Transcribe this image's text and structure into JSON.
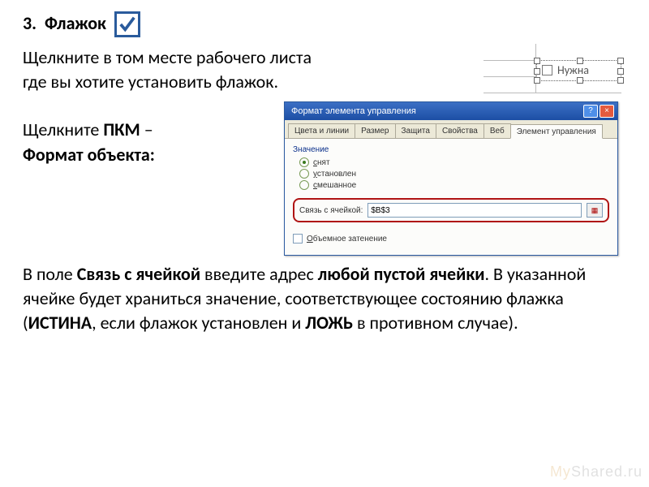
{
  "heading": {
    "number": "3.",
    "title": "Флажок"
  },
  "para1_line1": "Щелкните в том месте рабочего листа",
  "para1_line2": "где вы хотите установить флажок.",
  "rmb_instruction": {
    "prefix": "Щелкните ",
    "pkm": "ПКМ",
    "dash": " – ",
    "rest": "Формат объекта:"
  },
  "sample_checkbox_label": "Нужна",
  "dialog": {
    "title": "Формат элемента управления",
    "tabs": [
      "Цвета и линии",
      "Размер",
      "Защита",
      "Свойства",
      "Веб",
      "Элемент управления"
    ],
    "active_tab_index": 5,
    "group_label": "Значение",
    "radios": [
      {
        "label_u": "с",
        "label_rest": "нят",
        "selected": true
      },
      {
        "label_u": "у",
        "label_rest": "становлен",
        "selected": false
      },
      {
        "label_u": "с",
        "label_rest": "мешанное",
        "selected": false
      }
    ],
    "cell_link_label": "Связь с ячейкой:",
    "cell_link_value": "$B$3",
    "shadow_label_u": "О",
    "shadow_label_rest": "бъемное затенение"
  },
  "para2": {
    "t1": "В поле ",
    "b1": "Связь с ячейкой",
    "t2": " введите адрес ",
    "b2": "любой пустой ячейки",
    "t3": ". В указанной ячейке будет храниться значение, соответствующее состоянию флажка (",
    "b3": "ИСТИНА",
    "t4": ", если флажок установлен и ",
    "b4": "ЛОЖЬ",
    "t5": " в противном случае)."
  },
  "watermark": {
    "left": "My",
    "right": "Shared"
  }
}
